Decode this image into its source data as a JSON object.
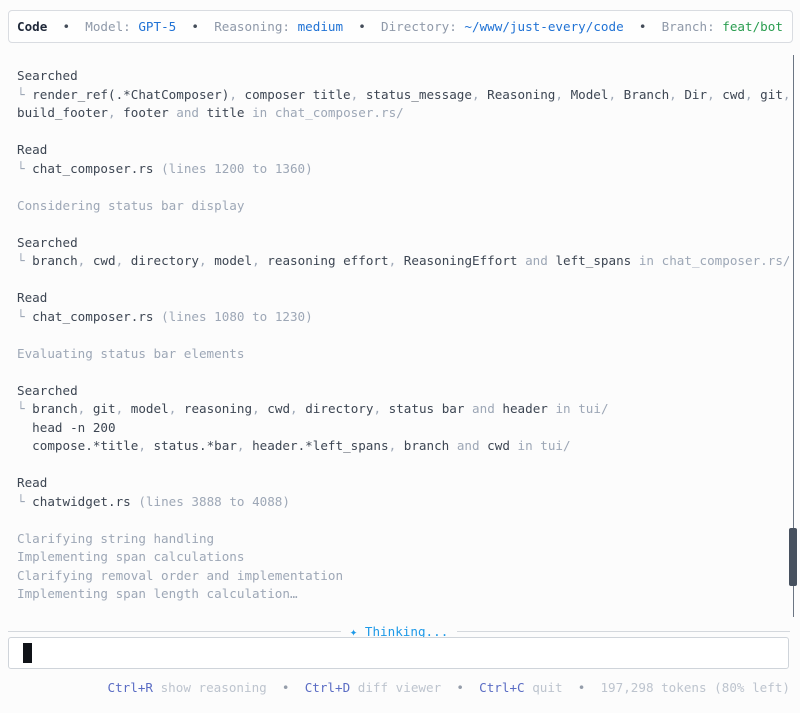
{
  "colors": {
    "background": "#fcfcfc",
    "text_dark": "#3d4653",
    "text_gray": "#9da7b6",
    "accent_blue": "#2173d5",
    "branch_green": "#2a9d50",
    "thinking_blue": "#1d99e8",
    "shortcut_key_blue": "#5a6cc4",
    "footer_gray": "#bdc4ce",
    "border_gray": "#d9dce1",
    "scrollbar_thumb": "#47515f"
  },
  "status_bar": {
    "segments": [
      {
        "c": "bold",
        "t": "Code"
      },
      {
        "c": "bul",
        "t": "  •  "
      },
      {
        "c": "lbl",
        "t": "Model: "
      },
      {
        "c": "b",
        "t": "GPT-5"
      },
      {
        "c": "bul",
        "t": "  •  "
      },
      {
        "c": "lbl",
        "t": "Reasoning: "
      },
      {
        "c": "b",
        "t": "medium"
      },
      {
        "c": "bul",
        "t": "  •  "
      },
      {
        "c": "lbl",
        "t": "Directory: "
      },
      {
        "c": "b",
        "t": "~/www/just-every/code"
      },
      {
        "c": "bul",
        "t": "  •  "
      },
      {
        "c": "lbl",
        "t": "Branch: "
      },
      {
        "c": "gr",
        "t": "feat/bot"
      }
    ]
  },
  "history": {
    "lines": [
      [
        {
          "c": "d",
          "t": "Searched"
        }
      ],
      [
        {
          "c": "g",
          "t": "└ "
        },
        {
          "c": "d",
          "t": "render_ref(.*ChatComposer)"
        },
        {
          "c": "g",
          "t": ", "
        },
        {
          "c": "d",
          "t": "composer title"
        },
        {
          "c": "g",
          "t": ", "
        },
        {
          "c": "d",
          "t": "status_message"
        },
        {
          "c": "g",
          "t": ", "
        },
        {
          "c": "d",
          "t": "Reasoning"
        },
        {
          "c": "g",
          "t": ", "
        },
        {
          "c": "d",
          "t": "Model"
        },
        {
          "c": "g",
          "t": ", "
        },
        {
          "c": "d",
          "t": "Branch"
        },
        {
          "c": "g",
          "t": ", "
        },
        {
          "c": "d",
          "t": "Dir"
        },
        {
          "c": "g",
          "t": ", "
        },
        {
          "c": "d",
          "t": "cwd"
        },
        {
          "c": "g",
          "t": ", "
        },
        {
          "c": "d",
          "t": "git"
        },
        {
          "c": "g",
          "t": ","
        }
      ],
      [
        {
          "c": "d",
          "t": "build_footer"
        },
        {
          "c": "g",
          "t": ", "
        },
        {
          "c": "d",
          "t": "footer"
        },
        {
          "c": "g",
          "t": " and "
        },
        {
          "c": "d",
          "t": "title"
        },
        {
          "c": "g",
          "t": " in "
        },
        {
          "c": "g",
          "t": "chat_composer.rs/"
        }
      ],
      [],
      [
        {
          "c": "d",
          "t": "Read"
        }
      ],
      [
        {
          "c": "g",
          "t": "└ "
        },
        {
          "c": "d",
          "t": "chat_composer.rs"
        },
        {
          "c": "g",
          "t": " (lines 1200 to 1360)"
        }
      ],
      [],
      [
        {
          "c": "g",
          "t": "Considering status bar display"
        }
      ],
      [],
      [
        {
          "c": "d",
          "t": "Searched"
        }
      ],
      [
        {
          "c": "g",
          "t": "└ "
        },
        {
          "c": "d",
          "t": "branch"
        },
        {
          "c": "g",
          "t": ", "
        },
        {
          "c": "d",
          "t": "cwd"
        },
        {
          "c": "g",
          "t": ", "
        },
        {
          "c": "d",
          "t": "directory"
        },
        {
          "c": "g",
          "t": ", "
        },
        {
          "c": "d",
          "t": "model"
        },
        {
          "c": "g",
          "t": ", "
        },
        {
          "c": "d",
          "t": "reasoning effort"
        },
        {
          "c": "g",
          "t": ", "
        },
        {
          "c": "d",
          "t": "ReasoningEffort"
        },
        {
          "c": "g",
          "t": " and "
        },
        {
          "c": "d",
          "t": "left_spans"
        },
        {
          "c": "g",
          "t": " in "
        },
        {
          "c": "g",
          "t": "chat_composer.rs/"
        }
      ],
      [],
      [
        {
          "c": "d",
          "t": "Read"
        }
      ],
      [
        {
          "c": "g",
          "t": "└ "
        },
        {
          "c": "d",
          "t": "chat_composer.rs"
        },
        {
          "c": "g",
          "t": " (lines 1080 to 1230)"
        }
      ],
      [],
      [
        {
          "c": "g",
          "t": "Evaluating status bar elements"
        }
      ],
      [],
      [
        {
          "c": "d",
          "t": "Searched"
        }
      ],
      [
        {
          "c": "g",
          "t": "└ "
        },
        {
          "c": "d",
          "t": "branch"
        },
        {
          "c": "g",
          "t": ", "
        },
        {
          "c": "d",
          "t": "git"
        },
        {
          "c": "g",
          "t": ", "
        },
        {
          "c": "d",
          "t": "model"
        },
        {
          "c": "g",
          "t": ", "
        },
        {
          "c": "d",
          "t": "reasoning"
        },
        {
          "c": "g",
          "t": ", "
        },
        {
          "c": "d",
          "t": "cwd"
        },
        {
          "c": "g",
          "t": ", "
        },
        {
          "c": "d",
          "t": "directory"
        },
        {
          "c": "g",
          "t": ", "
        },
        {
          "c": "d",
          "t": "status bar"
        },
        {
          "c": "g",
          "t": " and "
        },
        {
          "c": "d",
          "t": "header"
        },
        {
          "c": "g",
          "t": " in "
        },
        {
          "c": "g",
          "t": "tui/"
        }
      ],
      [
        {
          "c": "d",
          "t": "  head -n 200"
        }
      ],
      [
        {
          "c": "d",
          "t": "  compose.*title"
        },
        {
          "c": "g",
          "t": ", "
        },
        {
          "c": "d",
          "t": "status.*bar"
        },
        {
          "c": "g",
          "t": ", "
        },
        {
          "c": "d",
          "t": "header.*left_spans"
        },
        {
          "c": "g",
          "t": ", "
        },
        {
          "c": "d",
          "t": "branch"
        },
        {
          "c": "g",
          "t": " and "
        },
        {
          "c": "d",
          "t": "cwd"
        },
        {
          "c": "g",
          "t": " in "
        },
        {
          "c": "g",
          "t": "tui/"
        }
      ],
      [],
      [
        {
          "c": "d",
          "t": "Read"
        }
      ],
      [
        {
          "c": "g",
          "t": "└ "
        },
        {
          "c": "d",
          "t": "chatwidget.rs"
        },
        {
          "c": "g",
          "t": " (lines 3888 to 4088)"
        }
      ],
      [],
      [
        {
          "c": "g",
          "t": "Clarifying string handling"
        }
      ],
      [
        {
          "c": "g",
          "t": "Implementing span calculations"
        }
      ],
      [
        {
          "c": "g",
          "t": "Clarifying removal order and implementation"
        }
      ],
      [
        {
          "c": "g",
          "t": "Implementing span length calculation…"
        }
      ]
    ]
  },
  "composer": {
    "thinking_icon": "✦",
    "thinking_label": "Thinking...",
    "input_value": ""
  },
  "footer": {
    "segments": [
      {
        "c": "k",
        "t": "Ctrl+R"
      },
      {
        "c": "fg",
        "t": " show reasoning  "
      },
      {
        "c": "fb",
        "t": "•"
      },
      {
        "c": "fg",
        "t": "  "
      },
      {
        "c": "k",
        "t": "Ctrl+D"
      },
      {
        "c": "fg",
        "t": " diff viewer  "
      },
      {
        "c": "fb",
        "t": "•"
      },
      {
        "c": "fg",
        "t": "  "
      },
      {
        "c": "k",
        "t": "Ctrl+C"
      },
      {
        "c": "fg",
        "t": " quit  "
      },
      {
        "c": "fb",
        "t": "•"
      },
      {
        "c": "fg",
        "t": "  197,298 tokens (80% left)"
      }
    ]
  }
}
